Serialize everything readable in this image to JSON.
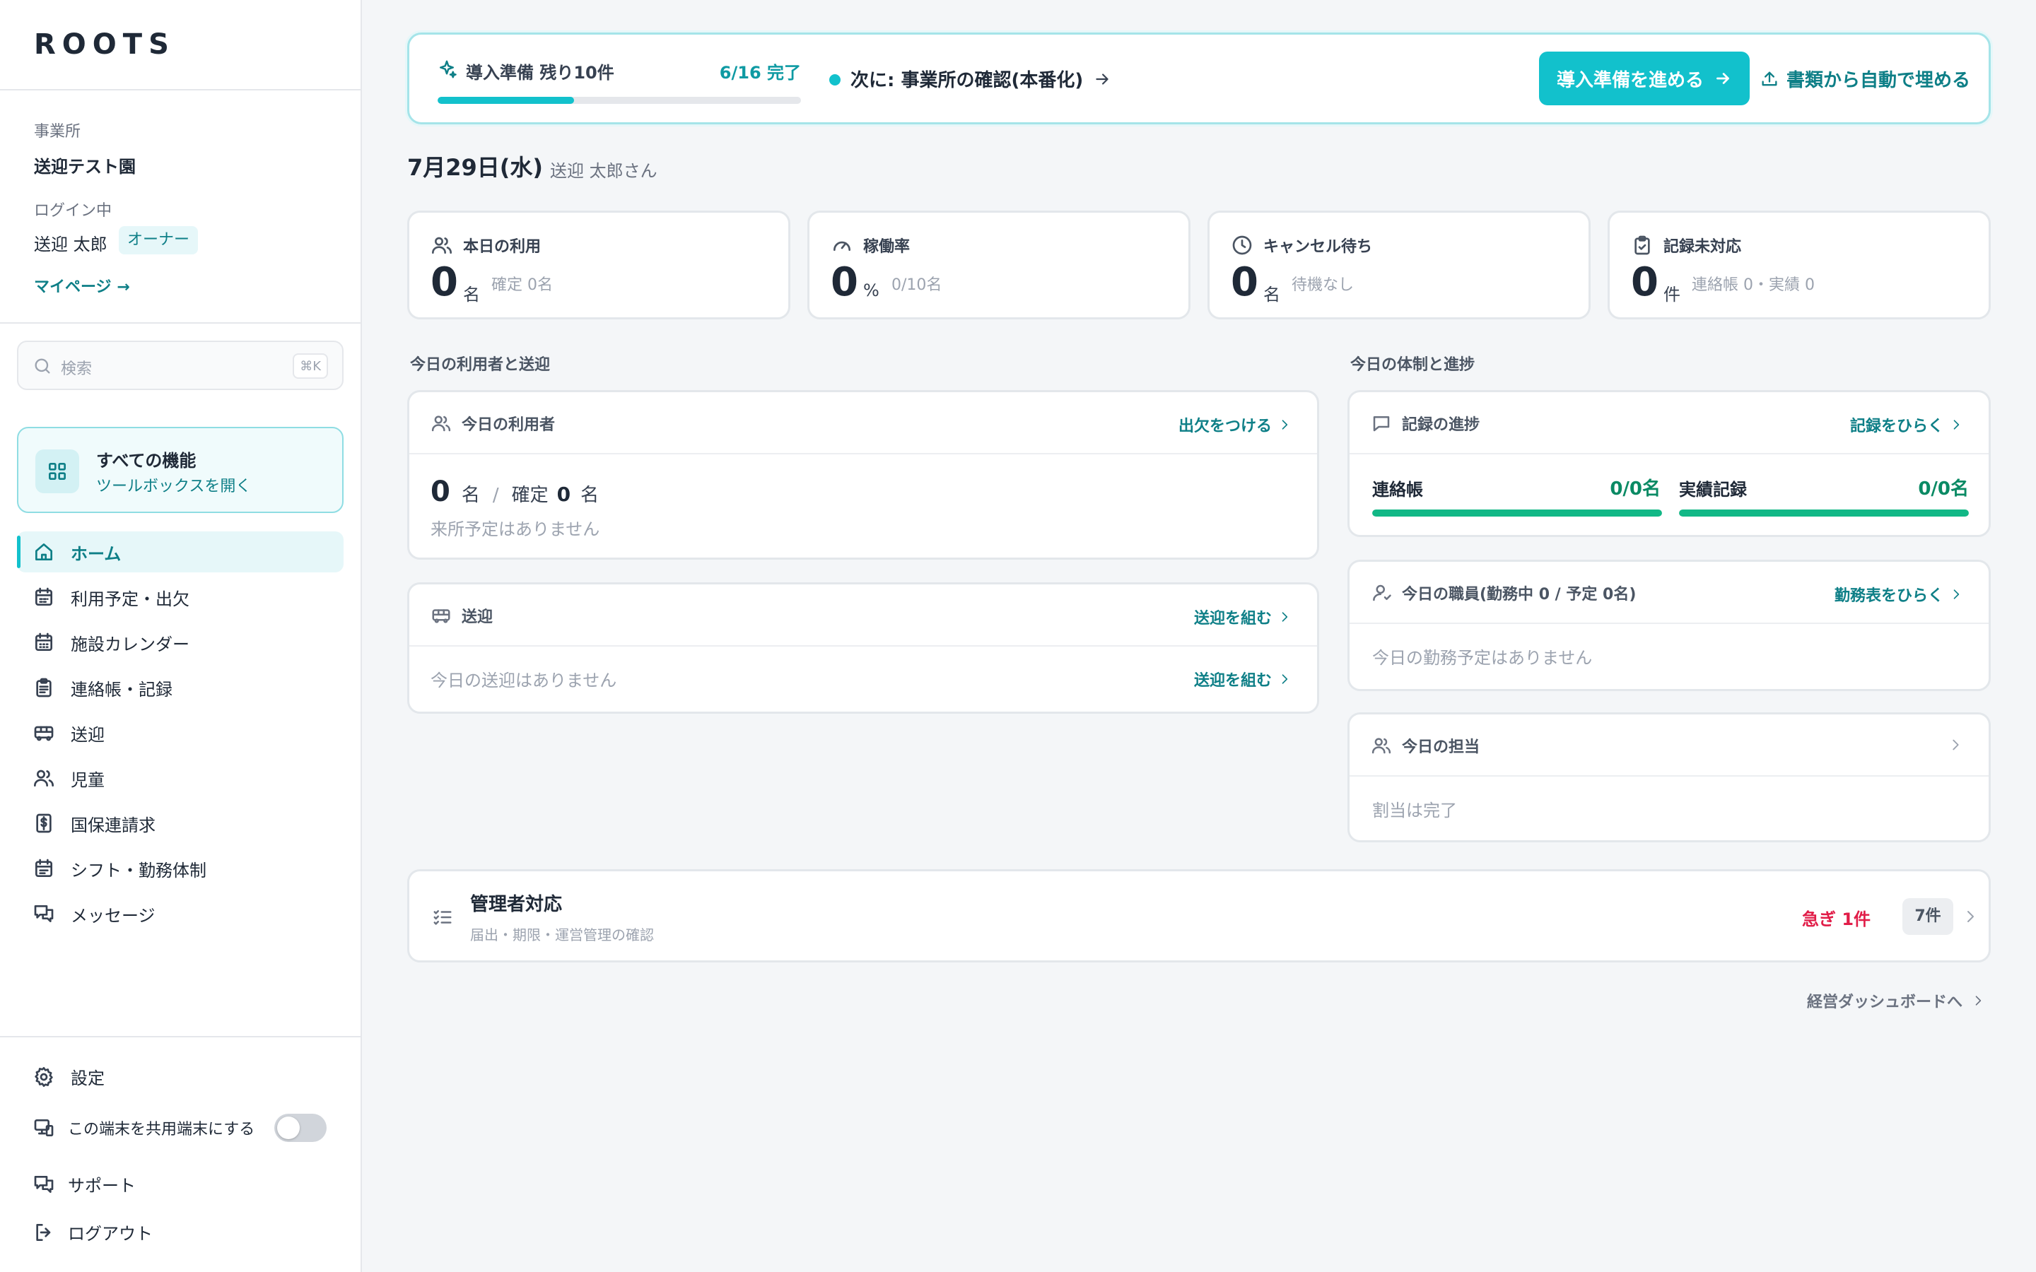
{
  "app": {
    "logo": "ROOTS"
  },
  "sidebar": {
    "office_label": "事業所",
    "office_name": "送迎テスト園",
    "login_label": "ログイン中",
    "user_name": "送迎 太郎",
    "role_badge": "オーナー",
    "mypage_link": "マイページ →",
    "search": {
      "placeholder": "検索",
      "shortcut": "⌘K"
    },
    "all_features": {
      "title": "すべての機能",
      "subtitle": "ツールボックスを開く"
    },
    "nav": [
      {
        "label": "ホーム",
        "icon": "home-icon",
        "active": true
      },
      {
        "label": "利用予定・出欠",
        "icon": "calendar-icon"
      },
      {
        "label": "施設カレンダー",
        "icon": "calendar-grid-icon"
      },
      {
        "label": "連絡帳・記録",
        "icon": "clipboard-icon"
      },
      {
        "label": "送迎",
        "icon": "bus-icon"
      },
      {
        "label": "児童",
        "icon": "users-icon"
      },
      {
        "label": "国保連請求",
        "icon": "dollar-doc-icon"
      },
      {
        "label": "シフト・勤務体制",
        "icon": "schedule-icon"
      },
      {
        "label": "メッセージ",
        "icon": "message-icon"
      }
    ],
    "bottom": {
      "settings": "設定",
      "shared_device": "この端末を共用端末にする",
      "shared_device_on": false,
      "support": "サポート",
      "logout": "ログアウト"
    }
  },
  "onboarding": {
    "title": "導入準備 残り10件",
    "progress_text": "6/16 完了",
    "progress_done": 6,
    "progress_total": 16,
    "next_step": "次に: 事業所の確認(本番化)",
    "primary_button": "導入準備を進める",
    "secondary_button": "書類から自動で埋める",
    "accent": "#12c1cc"
  },
  "date_header": {
    "date": "7月29日(水)",
    "greeting": "送迎 太郎さん"
  },
  "kpis": [
    {
      "title": "本日の利用",
      "value": "0",
      "unit": "名",
      "sub": "確定 0名",
      "icon": "users-icon"
    },
    {
      "title": "稼働率",
      "value": "0",
      "unit": "%",
      "sub": "0/10名",
      "icon": "gauge-icon"
    },
    {
      "title": "キャンセル待ち",
      "value": "0",
      "unit": "名",
      "sub": "待機なし",
      "icon": "clock-icon"
    },
    {
      "title": "記録未対応",
      "value": "0",
      "unit": "件",
      "sub": "連絡帳 0・実績 0",
      "icon": "clipboard-check-icon"
    }
  ],
  "left_section": {
    "label": "今日の利用者と送迎",
    "users_panel": {
      "title": "今日の利用者",
      "link": "出欠をつける",
      "count": "0",
      "unit1": "名",
      "sep": "/",
      "confirmed_label": "確定",
      "confirmed": "0",
      "unit2": "名",
      "empty": "来所予定はありません"
    },
    "transport_panel": {
      "title": "送迎",
      "link": "送迎を組む",
      "empty": "今日の送迎はありません",
      "row_link": "送迎を組む"
    }
  },
  "right_section": {
    "label": "今日の体制と進捗",
    "records_panel": {
      "title": "記録の進捗",
      "link": "記録をひらく",
      "items": [
        {
          "label": "連絡帳",
          "value": "0/0名",
          "progress": 1.0
        },
        {
          "label": "実績記録",
          "value": "0/0名",
          "progress": 1.0
        }
      ],
      "bar_color": "#12b886"
    },
    "staff_panel": {
      "title": "今日の職員(勤務中 0 / 予定 0名)",
      "link": "勤務表をひらく",
      "empty": "今日の勤務予定はありません"
    },
    "assign_panel": {
      "title": "今日の担当",
      "body": "割当は完了"
    }
  },
  "admin": {
    "title": "管理者対応",
    "subtitle": "届出・期限・運営管理の確認",
    "urgent": "急ぎ 1件",
    "count_badge": "7件",
    "urgent_color": "#e11d48"
  },
  "footer_link": "経営ダッシュボードへ"
}
